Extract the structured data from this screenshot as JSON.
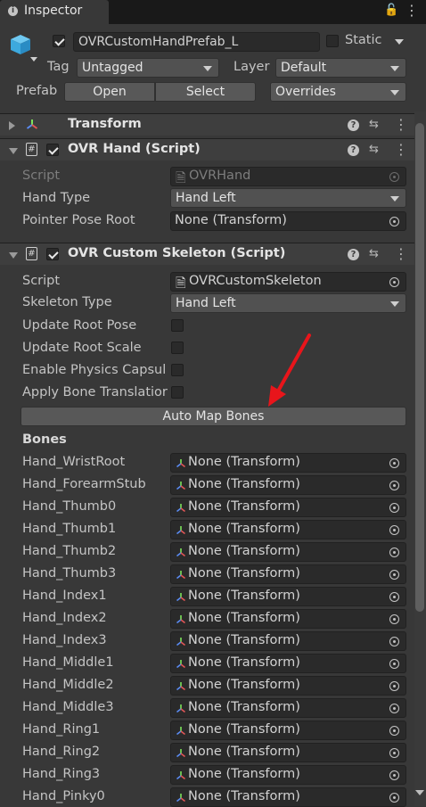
{
  "window": {
    "tab_title": "Inspector",
    "tab_icon": "info-icon"
  },
  "header": {
    "object_name": "OVRCustomHandPrefab_L",
    "active_checked": true,
    "static_label": "Static",
    "static_checked": false,
    "tag_label": "Tag",
    "tag_value": "Untagged",
    "layer_label": "Layer",
    "layer_value": "Default",
    "prefab_label": "Prefab",
    "open_label": "Open",
    "select_label": "Select",
    "overrides_label": "Overrides"
  },
  "transform": {
    "title": "Transform",
    "expanded": false
  },
  "ovr_hand": {
    "title": "OVR Hand (Script)",
    "enabled": true,
    "script_label": "Script",
    "script_value": "OVRHand",
    "hand_type_label": "Hand Type",
    "hand_type_value": "Hand Left",
    "pointer_pose_label": "Pointer Pose Root",
    "pointer_pose_value": "None (Transform)"
  },
  "skeleton": {
    "title": "OVR Custom Skeleton (Script)",
    "enabled": true,
    "script_label": "Script",
    "script_value": "OVRCustomSkeleton",
    "skeleton_type_label": "Skeleton Type",
    "skeleton_type_value": "Hand Left",
    "update_root_pose_label": "Update Root Pose",
    "update_root_scale_label": "Update Root Scale",
    "enable_physics_label": "Enable Physics Capsul",
    "apply_bone_label": "Apply Bone Translatior",
    "auto_map_label": "Auto Map Bones",
    "bones_heading": "Bones",
    "bones": [
      {
        "label": "Hand_WristRoot",
        "value": "None (Transform)"
      },
      {
        "label": "Hand_ForearmStub",
        "value": "None (Transform)"
      },
      {
        "label": "Hand_Thumb0",
        "value": "None (Transform)"
      },
      {
        "label": "Hand_Thumb1",
        "value": "None (Transform)"
      },
      {
        "label": "Hand_Thumb2",
        "value": "None (Transform)"
      },
      {
        "label": "Hand_Thumb3",
        "value": "None (Transform)"
      },
      {
        "label": "Hand_Index1",
        "value": "None (Transform)"
      },
      {
        "label": "Hand_Index2",
        "value": "None (Transform)"
      },
      {
        "label": "Hand_Index3",
        "value": "None (Transform)"
      },
      {
        "label": "Hand_Middle1",
        "value": "None (Transform)"
      },
      {
        "label": "Hand_Middle2",
        "value": "None (Transform)"
      },
      {
        "label": "Hand_Middle3",
        "value": "None (Transform)"
      },
      {
        "label": "Hand_Ring1",
        "value": "None (Transform)"
      },
      {
        "label": "Hand_Ring2",
        "value": "None (Transform)"
      },
      {
        "label": "Hand_Ring3",
        "value": "None (Transform)"
      },
      {
        "label": "Hand_Pinky0",
        "value": "None (Transform)"
      }
    ]
  },
  "colors": {
    "background": "#383838",
    "annotation_arrow": "#e8151b"
  }
}
